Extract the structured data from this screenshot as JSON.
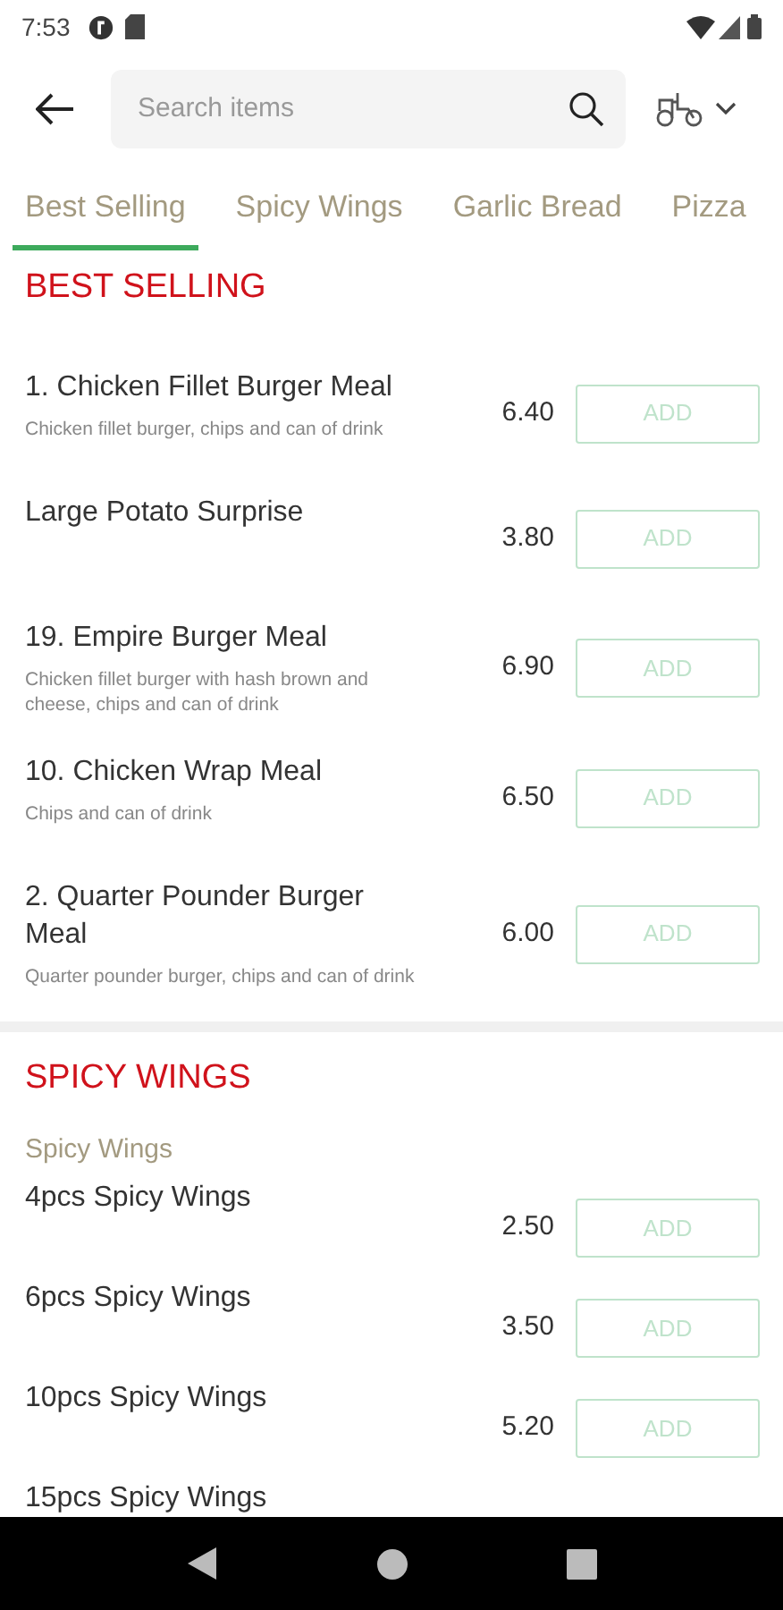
{
  "status_bar": {
    "time": "7:53"
  },
  "search": {
    "placeholder": "Search items"
  },
  "tabs": [
    {
      "label": "Best Selling",
      "selected": true
    },
    {
      "label": "Spicy Wings",
      "selected": false
    },
    {
      "label": "Garlic Bread",
      "selected": false
    },
    {
      "label": "Pizza",
      "selected": false
    }
  ],
  "sections": [
    {
      "title": "BEST SELLING",
      "items": [
        {
          "name": "1. Chicken Fillet Burger Meal",
          "description": "Chicken fillet burger, chips and can of drink",
          "price": "6.40",
          "button": "ADD"
        },
        {
          "name": "Large Potato Surprise",
          "price": "3.80",
          "button": "ADD"
        },
        {
          "name": "19. Empire Burger Meal",
          "description": "Chicken fillet burger with hash brown and cheese, chips and can of drink",
          "price": "6.90",
          "button": "ADD"
        },
        {
          "name": "10. Chicken Wrap Meal",
          "description": "Chips and can of drink",
          "price": "6.50",
          "button": "ADD"
        },
        {
          "name": "2. Quarter Pounder Burger Meal",
          "description": "Quarter pounder burger, chips and can of drink",
          "price": "6.00",
          "button": "ADD"
        }
      ]
    },
    {
      "title": "SPICY WINGS",
      "subtitle": "Spicy Wings",
      "items": [
        {
          "name": "4pcs Spicy Wings",
          "price": "2.50",
          "button": "ADD"
        },
        {
          "name": "6pcs Spicy Wings",
          "price": "3.50",
          "button": "ADD"
        },
        {
          "name": "10pcs Spicy Wings",
          "price": "5.20",
          "button": "ADD"
        },
        {
          "name": "15pcs Spicy Wings"
        }
      ]
    }
  ]
}
